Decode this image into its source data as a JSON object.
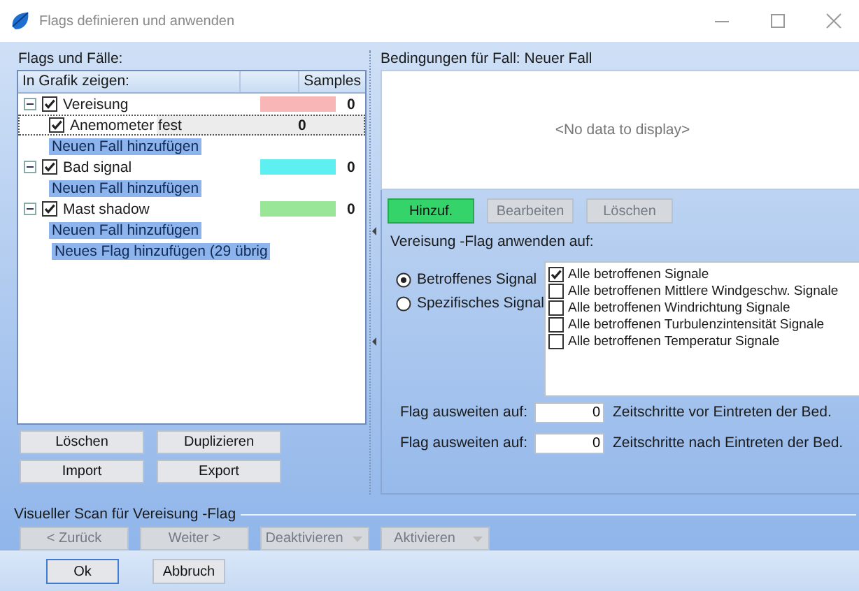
{
  "window": {
    "title": "Flags definieren und anwenden"
  },
  "flags_panel": {
    "title": "Flags und Fälle:",
    "columns": [
      "In Grafik zeigen:",
      "Samples"
    ],
    "flags": [
      {
        "label": "Vereisung",
        "checked": true,
        "expanded": true,
        "color": "#f9b6b6",
        "samples": "0",
        "cases": [
          {
            "label": "Anemometer fest",
            "checked": true,
            "samples": "0",
            "focused": true
          }
        ],
        "add_case": "Neuen Fall hinzufügen"
      },
      {
        "label": "Bad signal",
        "checked": true,
        "expanded": true,
        "color": "#5ef0f0",
        "samples": "0",
        "add_case": "Neuen Fall hinzufügen"
      },
      {
        "label": "Mast shadow",
        "checked": true,
        "expanded": true,
        "color": "#99e699",
        "samples": "0",
        "add_case": "Neuen Fall hinzufügen"
      }
    ],
    "add_flag": "Neues Flag hinzufügen (29 übrig",
    "buttons": [
      [
        "Löschen",
        "Duplizieren"
      ],
      [
        "Import",
        "Export"
      ]
    ]
  },
  "conditions": {
    "title": "Bedingungen für Fall: Neuer Fall",
    "empty_text": "<No data to display>",
    "buttons": [
      {
        "label": "Hinzuf.",
        "disabled": false
      },
      {
        "label": "Bearbeiten",
        "disabled": true
      },
      {
        "label": "Löschen",
        "disabled": true
      }
    ],
    "apply_title": "Vereisung -Flag anwenden auf:",
    "radios": [
      {
        "label": "Betroffenes Signal",
        "selected": true
      },
      {
        "label": "Spezifisches Signal",
        "selected": false
      }
    ],
    "signals": [
      {
        "label": "Alle betroffenen Signale",
        "checked": true
      },
      {
        "label": "Alle betroffenen Mittlere Windgeschw. Signale",
        "checked": false
      },
      {
        "label": "Alle betroffenen Windrichtung Signale",
        "checked": false
      },
      {
        "label": "Alle betroffenen Turbulenzintensität Signale",
        "checked": false
      },
      {
        "label": "Alle betroffenen Temperatur Signale",
        "checked": false
      }
    ],
    "extend": [
      {
        "label": "Flag ausweiten auf:",
        "value": "0",
        "suffix": "Zeitschritte vor Eintreten der Bed."
      },
      {
        "label": "Flag ausweiten auf:",
        "value": "0",
        "suffix": "Zeitschritte nach Eintreten der Bed."
      }
    ]
  },
  "visual_scan": {
    "title": "Visueller Scan für Vereisung -Flag",
    "buttons": [
      {
        "label": "< Zurück",
        "disabled": true,
        "kind": "plain"
      },
      {
        "label": "Weiter >",
        "disabled": true,
        "kind": "plain"
      },
      {
        "label": "Deaktivieren",
        "disabled": true,
        "kind": "split"
      },
      {
        "label": "Aktivieren",
        "disabled": true,
        "kind": "split"
      }
    ]
  },
  "footer": {
    "buttons": [
      {
        "label": "Ok",
        "focused": true
      },
      {
        "label": "Abbruch",
        "focused": false
      }
    ]
  }
}
